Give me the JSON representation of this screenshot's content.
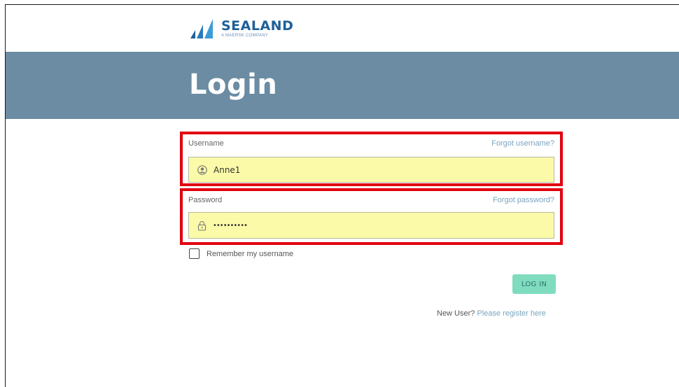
{
  "header": {
    "brand": "SEALAND",
    "tagline": "A MAERSK COMPANY",
    "logo_icon": "sails-logo-icon"
  },
  "banner": {
    "title": "Login"
  },
  "form": {
    "username": {
      "label": "Username",
      "forgot_link": "Forgot username?",
      "value": "Anne1",
      "icon": "user-icon"
    },
    "password": {
      "label": "Password",
      "forgot_link": "Forgot password?",
      "value": "••••••••••",
      "icon": "lock-icon"
    },
    "remember": {
      "label": "Remember my username",
      "checked": false
    },
    "login_button": "LOG IN",
    "register_prefix": "New User?",
    "register_link": "Please register here"
  },
  "colors": {
    "banner": "#6b8ca2",
    "highlight_border": "#e0000f",
    "input_fill": "#fbfaa8",
    "button": "#7fdcbe",
    "link": "#7aa4bf",
    "brand": "#1f5f99"
  }
}
